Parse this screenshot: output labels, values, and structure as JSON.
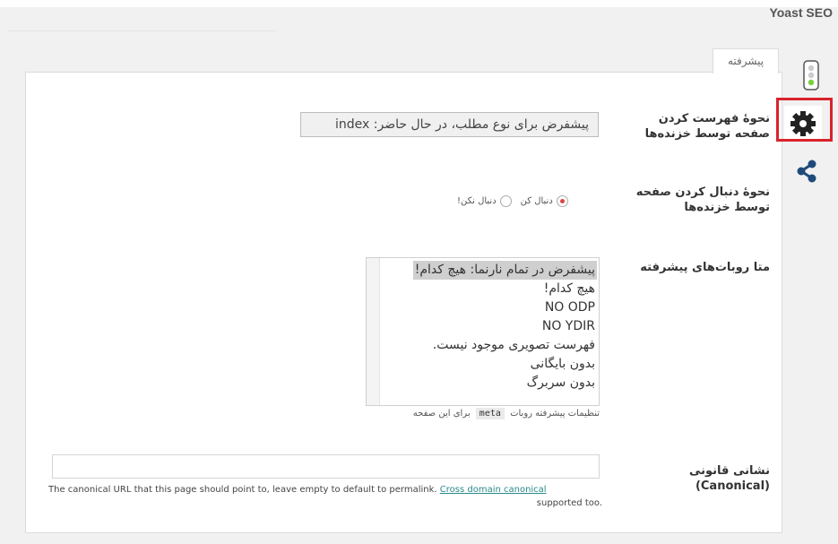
{
  "plugin_title": "Yoast SEO",
  "tab": {
    "label": "پیشرفته"
  },
  "sidebar_icons": [
    "traffic-light-icon",
    "gear-icon",
    "share-icon"
  ],
  "colors": {
    "highlight": "#d9232c",
    "icon": "#1e4b7a",
    "link": "#2a8a8a"
  },
  "index": {
    "label_line1": "نحوهٔ فهرست کردن",
    "label_line2": "صفحه توسط خزنده‌ها",
    "value": "پیشفرض برای نوع مطلب، در حال حاضر: index"
  },
  "follow": {
    "label_line1": "نحوهٔ دنبال کردن صفحه",
    "label_line2": "توسط خزنده‌ها",
    "option_follow": "دنبال کن",
    "option_nofollow": "دنبال نکن!",
    "selected": "follow"
  },
  "meta_robots": {
    "label": "متا روبات‌های پیشرفته",
    "options": [
      "پیشفرض در تمام نارنما: هیچ کدام!",
      "هیچ کدام!",
      "NO ODP",
      "NO YDIR",
      "فهرست تصویری موجود نیست.",
      "بدون بایگانی",
      "بدون سربرگ"
    ],
    "selected_index": 0,
    "help_before": "تنظیمات پیشرفته روبات",
    "help_code": "meta",
    "help_after": "برای این صفحه"
  },
  "canonical": {
    "label_line1": "نشانی قانونی",
    "label_line2": "(Canonical)",
    "value": "",
    "description": "The canonical URL that this page should point to, leave empty to default to permalink.",
    "link_text": "Cross domain canonical",
    "description_end": "supported too."
  }
}
